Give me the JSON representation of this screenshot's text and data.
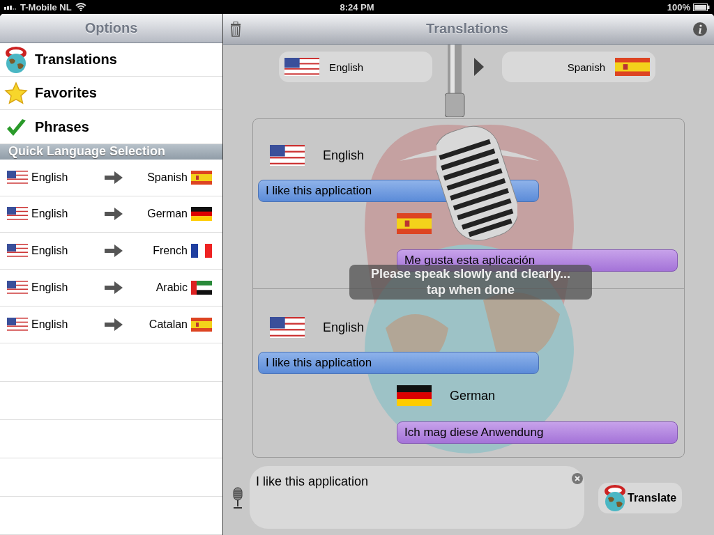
{
  "status_bar": {
    "carrier": "T-Mobile NL",
    "time": "8:24 PM",
    "battery": "100%"
  },
  "sidebar": {
    "title": "Options",
    "items": [
      {
        "label": "Translations",
        "kind": "tongue",
        "selected": false
      },
      {
        "label": "Favorites",
        "kind": "star",
        "selected": false
      },
      {
        "label": "Phrases",
        "kind": "check",
        "selected": false
      }
    ],
    "section_title": "Quick Language Selection",
    "quick_languages": [
      {
        "from": {
          "name": "English",
          "kind": "us"
        },
        "to": {
          "name": "Spanish",
          "kind": "es"
        }
      },
      {
        "from": {
          "name": "English",
          "kind": "us"
        },
        "to": {
          "name": "German",
          "kind": "de"
        }
      },
      {
        "from": {
          "name": "English",
          "kind": "us"
        },
        "to": {
          "name": "French",
          "kind": "fr"
        }
      },
      {
        "from": {
          "name": "English",
          "kind": "us"
        },
        "to": {
          "name": "Arabic",
          "kind": "ae"
        }
      },
      {
        "from": {
          "name": "English",
          "kind": "us"
        },
        "to": {
          "name": "Catalan",
          "kind": "es"
        }
      }
    ]
  },
  "main": {
    "title": "Translations",
    "source_language": {
      "name": "English",
      "kind": "us"
    },
    "target_language": {
      "name": "Spanish",
      "kind": "es"
    },
    "conversation": [
      {
        "from": {
          "name": "English",
          "kind": "us"
        },
        "text": "I like this application",
        "to": {
          "kind": "es"
        },
        "translation": "Me gusta esta aplicación"
      },
      {
        "from": {
          "name": "English",
          "kind": "us"
        },
        "text": "I like this application",
        "to": {
          "name": "German",
          "kind": "de"
        },
        "translation": "Ich mag diese Anwendung"
      }
    ],
    "input": {
      "value": "I like this application"
    },
    "translate_button": "Translate",
    "recording_hint": "Please speak slowly and clearly...\ntap when done"
  }
}
